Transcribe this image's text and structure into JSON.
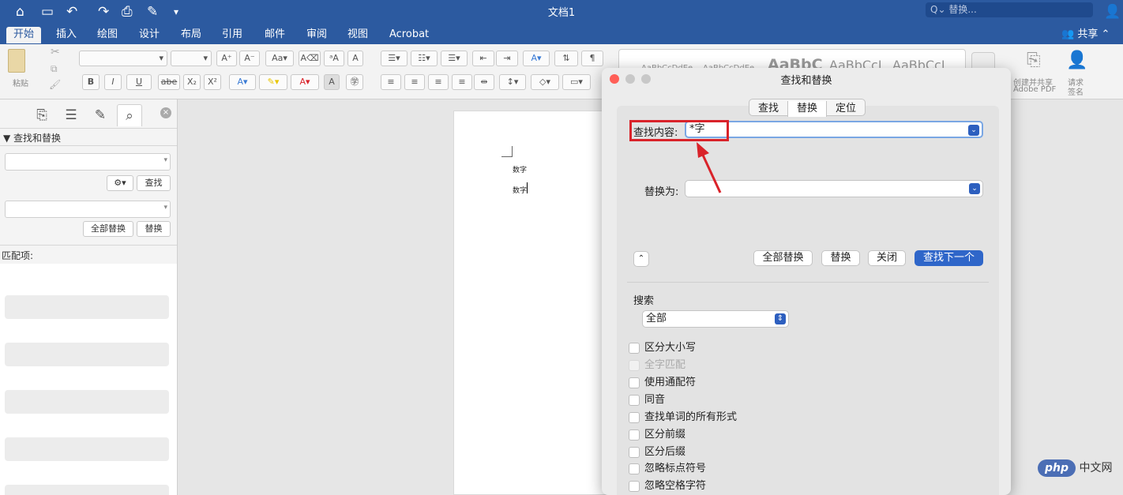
{
  "window": {
    "title": "文档1",
    "search_placeholder": "Q⌄ 替换..."
  },
  "ribbon": {
    "tabs": [
      "开始",
      "插入",
      "绘图",
      "设计",
      "布局",
      "引用",
      "邮件",
      "审阅",
      "视图",
      "Acrobat"
    ],
    "active_tab": 0,
    "share": "共享"
  },
  "toolbar": {
    "paste": "粘贴",
    "bold": "B",
    "italic": "I",
    "underline": "U",
    "strike": "abe",
    "subscript": "X₂",
    "superscript": "X²",
    "style_samples": [
      "AaBbCcDdEe",
      "AaBbCcDdEe",
      "AaBbC",
      "AaBbCcI",
      "AaBbCcI"
    ],
    "adobe_create": "创建并共享",
    "adobe_pdf": "Adobe PDF",
    "request_sign_1": "请求",
    "request_sign_2": "签名"
  },
  "sidebar": {
    "section_title": "▼ 查找和替换",
    "find_button": "查找",
    "replace_all_button": "全部替换",
    "replace_button": "替换",
    "matches_label": "匹配项:"
  },
  "document": {
    "line1": "数字",
    "line2": "数字"
  },
  "dialog": {
    "title": "查找和替换",
    "segments": [
      "查找",
      "替换",
      "定位"
    ],
    "active_segment": 1,
    "find_label": "查找内容:",
    "find_value": "*字",
    "replace_label": "替换为:",
    "replace_value": "",
    "buttons": {
      "replace_all": "全部替换",
      "replace": "替换",
      "close": "关闭",
      "find_next": "查找下一个"
    },
    "search_label": "搜索",
    "search_scope": "全部",
    "options": [
      {
        "label": "区分大小写",
        "checked": false,
        "enabled": true
      },
      {
        "label": "全字匹配",
        "checked": false,
        "enabled": false
      },
      {
        "label": "使用通配符",
        "checked": false,
        "enabled": true
      },
      {
        "label": "同音",
        "checked": false,
        "enabled": true
      },
      {
        "label": "查找单词的所有形式",
        "checked": false,
        "enabled": true
      },
      {
        "label": "区分前缀",
        "checked": false,
        "enabled": true
      },
      {
        "label": "区分后缀",
        "checked": false,
        "enabled": true
      },
      {
        "label": "忽略标点符号",
        "checked": false,
        "enabled": true
      },
      {
        "label": "忽略空格字符",
        "checked": false,
        "enabled": true
      }
    ]
  },
  "watermark": {
    "logo": "php",
    "text": "中文网"
  }
}
